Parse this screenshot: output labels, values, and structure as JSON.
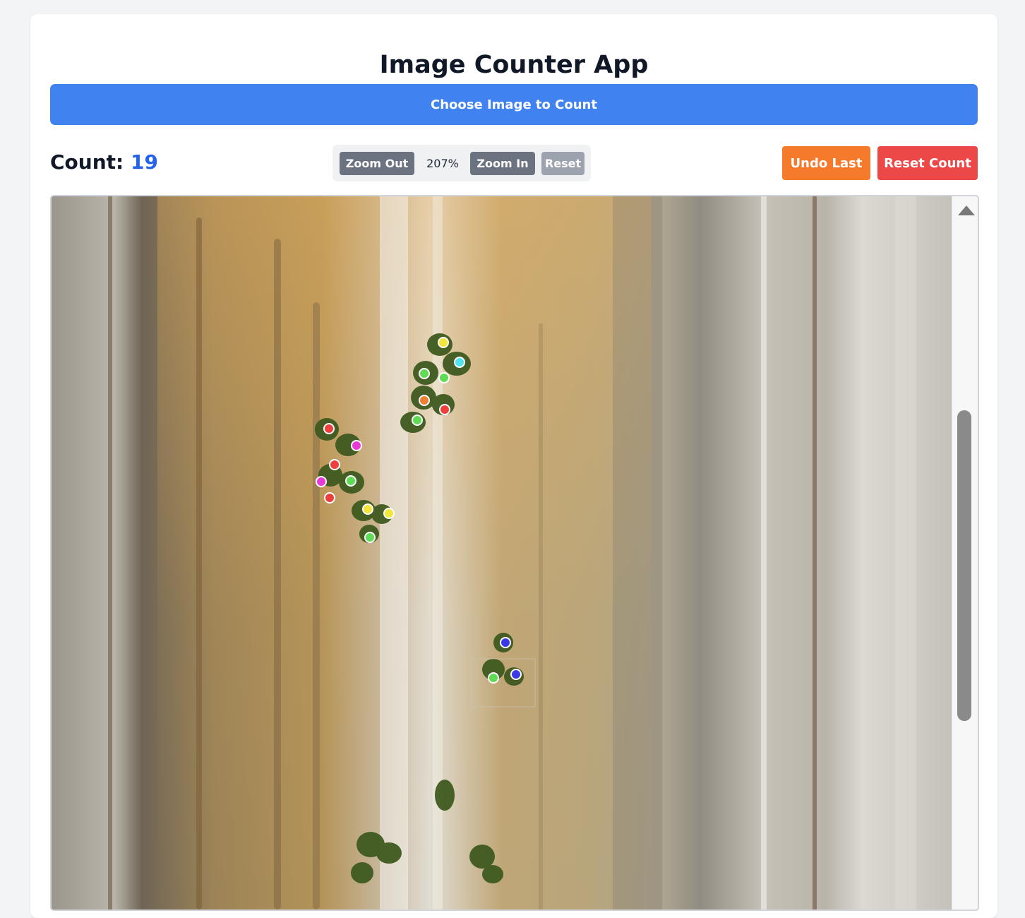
{
  "app": {
    "title": "Image Counter App",
    "choose_button_label": "Choose Image to Count"
  },
  "counter": {
    "label": "Count:",
    "value": "19"
  },
  "zoom": {
    "zoom_out_label": "Zoom Out",
    "level": "207%",
    "zoom_in_label": "Zoom In",
    "reset_label": "Reset"
  },
  "actions": {
    "undo_label": "Undo Last",
    "reset_count_label": "Reset Count"
  },
  "colors": {
    "primary": "#4083f0",
    "count_accent": "#2563eb",
    "undo": "#f67a2b",
    "reset_count": "#ec4848",
    "zoom_button": "#6b7280",
    "zoom_reset_disabled": "#9ca3af"
  },
  "markers": [
    {
      "color": "#f2e63a"
    },
    {
      "color": "#4fe3ef"
    },
    {
      "color": "#5fdb55"
    },
    {
      "color": "#5fdb55"
    },
    {
      "color": "#f08034"
    },
    {
      "color": "#ee3f3f"
    },
    {
      "color": "#5fdb55"
    },
    {
      "color": "#ee3f3f"
    },
    {
      "color": "#e838d6"
    },
    {
      "color": "#ee3f3f"
    },
    {
      "color": "#e838d6"
    },
    {
      "color": "#5fdb55"
    },
    {
      "color": "#ee3f3f"
    },
    {
      "color": "#f2e63a"
    },
    {
      "color": "#f2e63a"
    },
    {
      "color": "#5fdb55"
    },
    {
      "color": "#3a39e8"
    },
    {
      "color": "#5fdb55"
    },
    {
      "color": "#3a39e8"
    }
  ]
}
